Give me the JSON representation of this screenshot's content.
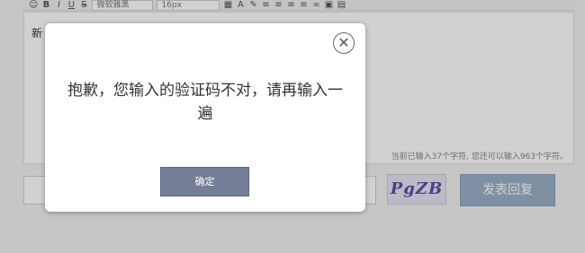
{
  "editor": {
    "toolbar": {
      "font_select_value": "微软雅黑",
      "size_select_value": "16px"
    },
    "content_text": "新",
    "char_count": "当前已输入37个字符, 您还可以输入963个字符。"
  },
  "reply": {
    "captcha_text": "PgZB",
    "submit_label": "发表回复"
  },
  "dialog": {
    "close_glyph": "✕",
    "message": "抱歉，您输入的验证码不对，请再输入一遍",
    "confirm_label": "确定"
  }
}
